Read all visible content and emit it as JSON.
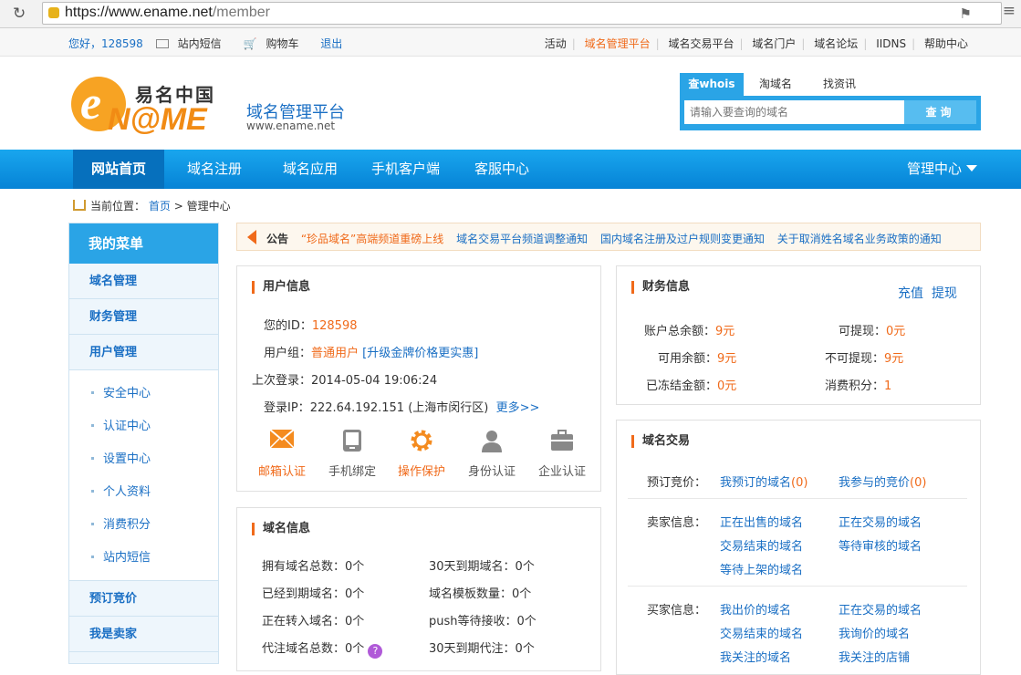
{
  "browser": {
    "url_host": "https://www.ename.net",
    "url_path": "/member"
  },
  "topbar": {
    "greeting": "您好，128598",
    "messages": "站内短信",
    "cart": "购物车",
    "logout": "退出",
    "links": [
      "活动",
      "域名管理平台",
      "域名交易平台",
      "域名门户",
      "域名论坛",
      "IIDNS",
      "帮助中心"
    ]
  },
  "header": {
    "logo_cn": "易名中国",
    "logo_en": "N@ME",
    "logo_e": "e",
    "platform": "域名管理平台",
    "site": "www.ename.net"
  },
  "search": {
    "tabs": [
      "查whois",
      "淘域名",
      "找资讯"
    ],
    "placeholder": "请输入要查询的域名",
    "button": "查询"
  },
  "nav": {
    "items": [
      "网站首页",
      "域名注册",
      "域名应用",
      "手机客户端",
      "客服中心"
    ],
    "manage": "管理中心"
  },
  "breadcrumb": {
    "label": "当前位置：",
    "home": "首页",
    "sep": ">",
    "current": "管理中心"
  },
  "sidebar": {
    "title": "我的菜单",
    "items": [
      "域名管理",
      "财务管理",
      "用户管理"
    ],
    "subs": [
      "安全中心",
      "认证中心",
      "设置中心",
      "个人资料",
      "消费积分",
      "站内短信"
    ],
    "bottom": [
      "预订竞价",
      "我是卖家"
    ]
  },
  "notice": {
    "label": "公告",
    "items": [
      "“珍品域名”高端频道重磅上线",
      "域名交易平台频道调整通知",
      "国内域名注册及过户规则变更通知",
      "关于取消姓名域名业务政策的通知"
    ]
  },
  "user": {
    "title": "用户信息",
    "id_label": "您的ID：",
    "id": "128598",
    "group_label": "用户组：",
    "group": "普通用户",
    "upgrade": "[升级金牌价格更实惠]",
    "last_login_label": "上次登录：",
    "last_login": "2014-05-04 19:06:24",
    "ip_label": "登录IP：",
    "ip": "222.64.192.151 (上海市闵行区)",
    "more": "更多>>",
    "badges": [
      "邮箱认证",
      "手机绑定",
      "操作保护",
      "身份认证",
      "企业认证"
    ]
  },
  "domain_info": {
    "title": "域名信息",
    "rows": [
      [
        "拥有域名总数：",
        "0个",
        "30天到期域名：",
        "0个"
      ],
      [
        "已经到期域名：",
        "0个",
        "域名模板数量：",
        "0个"
      ],
      [
        "正在转入域名：",
        "0个",
        "push等待接收：",
        "0个"
      ],
      [
        "代注域名总数：",
        "0个",
        "30天到期代注：",
        "0个"
      ]
    ]
  },
  "finance": {
    "title": "财务信息",
    "recharge": "充值",
    "withdraw": "提现",
    "rows": [
      [
        "账户总余额：",
        "9元",
        "可提现：",
        "0元"
      ],
      [
        "可用余额：",
        "9元",
        "不可提现：",
        "9元"
      ],
      [
        "已冻结金额：",
        "0元",
        "消费积分：",
        "1"
      ]
    ]
  },
  "trade": {
    "title": "域名交易",
    "booking_label": "预订竞价：",
    "my_booked": "我预订的域名",
    "my_booked_count": "(0)",
    "my_bids": "我参与的竞价",
    "my_bids_count": "(0)",
    "seller_label": "卖家信息：",
    "seller": [
      "正在出售的域名",
      "正在交易的域名",
      "交易结束的域名",
      "等待审核的域名",
      "等待上架的域名"
    ],
    "buyer_label": "买家信息：",
    "buyer": [
      "我出价的域名",
      "正在交易的域名",
      "交易结束的域名",
      "我询价的域名",
      "我关注的域名",
      "我关注的店铺"
    ]
  }
}
